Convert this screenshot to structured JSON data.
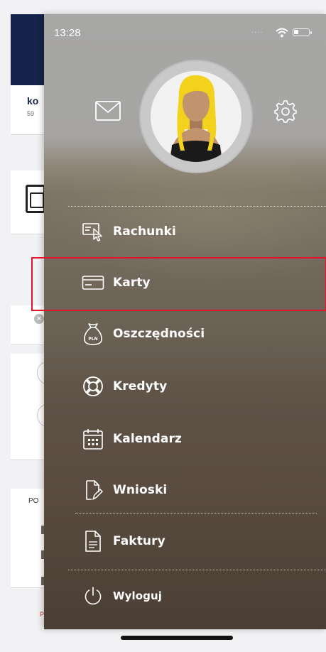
{
  "background": {
    "partial_title": "ko",
    "partial_number": "59",
    "partial_section": "PO",
    "partial_footer": "P"
  },
  "status_bar": {
    "time": "13:28",
    "signal": "....",
    "wifi_icon": "wifi-icon",
    "battery_icon": "battery-icon"
  },
  "drawer": {
    "messages_icon": "mail-icon",
    "settings_icon": "gear-icon",
    "avatar": "user-avatar",
    "menu_items": [
      {
        "label": "Rachunki",
        "icon": "accounts-icon"
      },
      {
        "label": "Karty",
        "icon": "card-icon"
      },
      {
        "label": "Oszczędności",
        "icon": "savings-bag-icon"
      },
      {
        "label": "Kredyty",
        "icon": "lifebuoy-icon"
      },
      {
        "label": "Kalendarz",
        "icon": "calendar-icon"
      },
      {
        "label": "Wnioski",
        "icon": "document-edit-icon"
      },
      {
        "label": "Faktury",
        "icon": "invoice-icon"
      },
      {
        "label": "Wyloguj",
        "icon": "power-icon"
      }
    ],
    "savings_icon_text": "PLN",
    "highlighted_item": "Karty",
    "highlight_color": "#e0152b"
  }
}
